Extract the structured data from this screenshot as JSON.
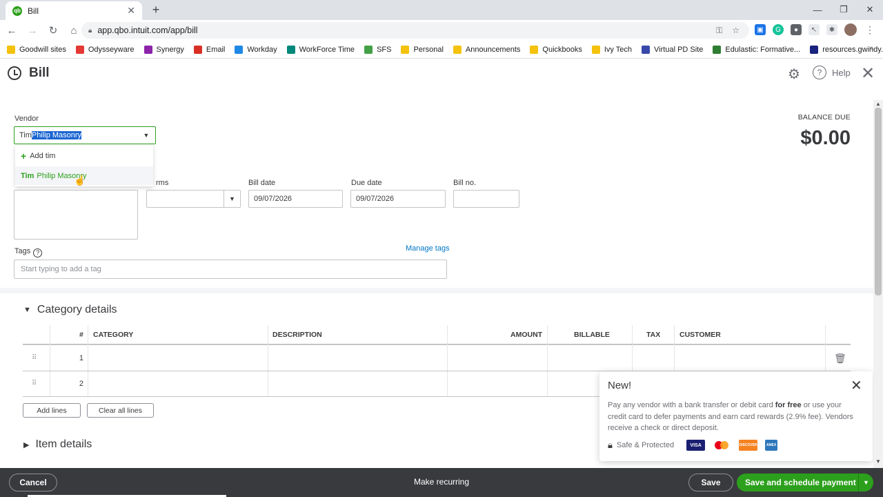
{
  "browser": {
    "tab_title": "Bill",
    "tab_icon": "qb",
    "url": "app.qbo.intuit.com/app/bill",
    "bookmarks": [
      {
        "label": "Goodwill sites",
        "color": "#f4c20d"
      },
      {
        "label": "Odysseyware",
        "color": "#e53935"
      },
      {
        "label": "Synergy",
        "color": "#8e24aa"
      },
      {
        "label": "Email",
        "color": "#d93025"
      },
      {
        "label": "Workday",
        "color": "#1e88e5"
      },
      {
        "label": "WorkForce Time",
        "color": "#00897b"
      },
      {
        "label": "SFS",
        "color": "#43a047"
      },
      {
        "label": "Personal",
        "color": "#f4c20d"
      },
      {
        "label": "Announcements",
        "color": "#f4c20d"
      },
      {
        "label": "Quickbooks",
        "color": "#f4c20d"
      },
      {
        "label": "Ivy Tech",
        "color": "#f4c20d"
      },
      {
        "label": "Virtual PD Site",
        "color": "#3949ab"
      },
      {
        "label": "Edulastic: Formative...",
        "color": "#2e7d32"
      },
      {
        "label": "resources.gwindy.org",
        "color": "#1a237e"
      }
    ]
  },
  "header": {
    "title": "Bill",
    "help_label": "Help"
  },
  "form": {
    "vendor_label": "Vendor",
    "vendor_typed": "Tim",
    "vendor_autocomplete": " Philip Masonry",
    "dropdown": {
      "add_prefix": "Add",
      "add_term": "tim",
      "option_match": "Tim",
      "option_rest": "Philip Masonry"
    },
    "terms_label": "rms",
    "bill_date_label": "Bill date",
    "bill_date_value": "09/07/2026",
    "due_date_label": "Due date",
    "due_date_value": "09/07/2026",
    "bill_no_label": "Bill no.",
    "bill_no_value": "",
    "tags_label": "Tags",
    "manage_tags": "Manage tags",
    "tags_placeholder": "Start typing to add a tag"
  },
  "balance": {
    "label": "BALANCE DUE",
    "amount": "$0.00"
  },
  "category_details": {
    "title": "Category details",
    "columns": [
      "#",
      "CATEGORY",
      "DESCRIPTION",
      "AMOUNT",
      "BILLABLE",
      "TAX",
      "CUSTOMER"
    ],
    "rows": [
      "1",
      "2"
    ],
    "add_lines": "Add lines",
    "clear_lines": "Clear all lines"
  },
  "item_details": {
    "title": "Item details"
  },
  "new_popup": {
    "title": "New!",
    "text_1": "Pay any vendor with a bank transfer or debit card ",
    "text_bold": "for free",
    "text_2": " or use your credit card to defer payments and earn card rewards (2.9% fee). Vendors receive a check or direct deposit.",
    "safe_label": "Safe & Protected",
    "cards": [
      "VISA",
      "",
      "DISCOVER",
      "AMEX"
    ]
  },
  "footer": {
    "cancel": "Cancel",
    "make_recurring": "Make recurring",
    "save": "Save",
    "save_schedule": "Save and schedule payment"
  },
  "colors": {
    "brand_green": "#2ca01c",
    "link_blue": "#0077c5",
    "footer_bg": "#393a3d"
  }
}
